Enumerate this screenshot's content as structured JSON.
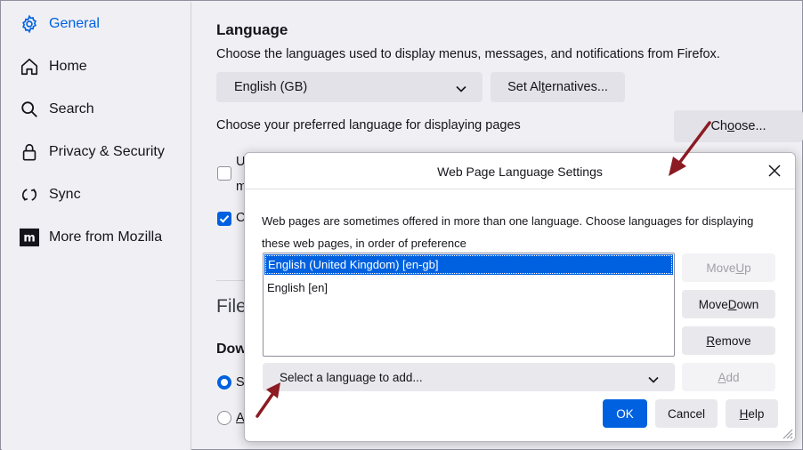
{
  "sidebar": {
    "items": [
      {
        "label": "General",
        "icon": "gear-icon",
        "active": true
      },
      {
        "label": "Home",
        "icon": "home-icon"
      },
      {
        "label": "Search",
        "icon": "search-icon"
      },
      {
        "label": "Privacy & Security",
        "icon": "lock-icon"
      },
      {
        "label": "Sync",
        "icon": "sync-icon"
      },
      {
        "label": "More from Mozilla",
        "icon": "mozilla-icon"
      }
    ]
  },
  "main": {
    "language_heading": "Language",
    "language_desc": "Choose the languages used to display menus, messages, and notifications from Firefox.",
    "ui_language_value": "English (GB)",
    "set_alternatives_pre": "Set Al",
    "set_alternatives_key": "t",
    "set_alternatives_post": "ernatives...",
    "pref_language_text": "Choose your preferred language for displaying pages",
    "choose_pre": "Ch",
    "choose_key": "o",
    "choose_post": "ose...",
    "clipped_1a": "U",
    "clipped_1b": "m",
    "clipped_2": "C",
    "files_heading_clipped": "File",
    "downloads_heading_clipped": "Dow",
    "radio_1_clipped": "S",
    "radio_2_clipped": "A"
  },
  "dialog": {
    "title": "Web Page Language Settings",
    "description": "Web pages are sometimes offered in more than one language. Choose languages for displaying these web pages, in order of preference",
    "languages": [
      {
        "label": "English (United Kingdom)  [en-gb]",
        "selected": true
      },
      {
        "label": "English  [en]",
        "selected": false
      }
    ],
    "move_up_pre": "Move ",
    "move_up_key": "U",
    "move_up_post": "p",
    "move_down_pre": "Move ",
    "move_down_key": "D",
    "move_down_post": "own",
    "remove_key": "R",
    "remove_post": "emove",
    "add_key": "A",
    "add_post": "dd",
    "add_select_placeholder": "Select a language to add...",
    "ok_label": "OK",
    "cancel_label": "Cancel",
    "help_key": "H",
    "help_post": "elp"
  },
  "colors": {
    "accent": "#0061e0",
    "annotation_arrow": "#8b1a22"
  }
}
